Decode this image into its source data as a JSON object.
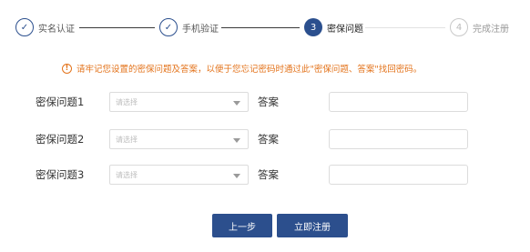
{
  "stepper": {
    "steps": [
      {
        "number": "",
        "label": "实名认证",
        "state": "done"
      },
      {
        "number": "",
        "label": "手机验证",
        "state": "done"
      },
      {
        "number": "3",
        "label": "密保问题",
        "state": "active"
      },
      {
        "number": "4",
        "label": "完成注册",
        "state": "todo"
      }
    ],
    "checkmark": "✓"
  },
  "notice": {
    "icon": "!",
    "text": "请牢记您设置的密保问题及答案，以便于您忘记密码时通过此\"密保问题、答案\"找回密码。"
  },
  "form": {
    "rows": [
      {
        "question_label": "密保问题1",
        "select_value": "请选择",
        "answer_label": "答案",
        "answer_value": ""
      },
      {
        "question_label": "密保问题2",
        "select_value": "请选择",
        "answer_label": "答案",
        "answer_value": ""
      },
      {
        "question_label": "密保问题3",
        "select_value": "请选择",
        "answer_label": "答案",
        "answer_value": ""
      }
    ]
  },
  "buttons": {
    "prev_label": "上一步",
    "submit_label": "立即注册"
  },
  "colors": {
    "accent": "#2c4f8d",
    "warning": "#e3731b"
  }
}
